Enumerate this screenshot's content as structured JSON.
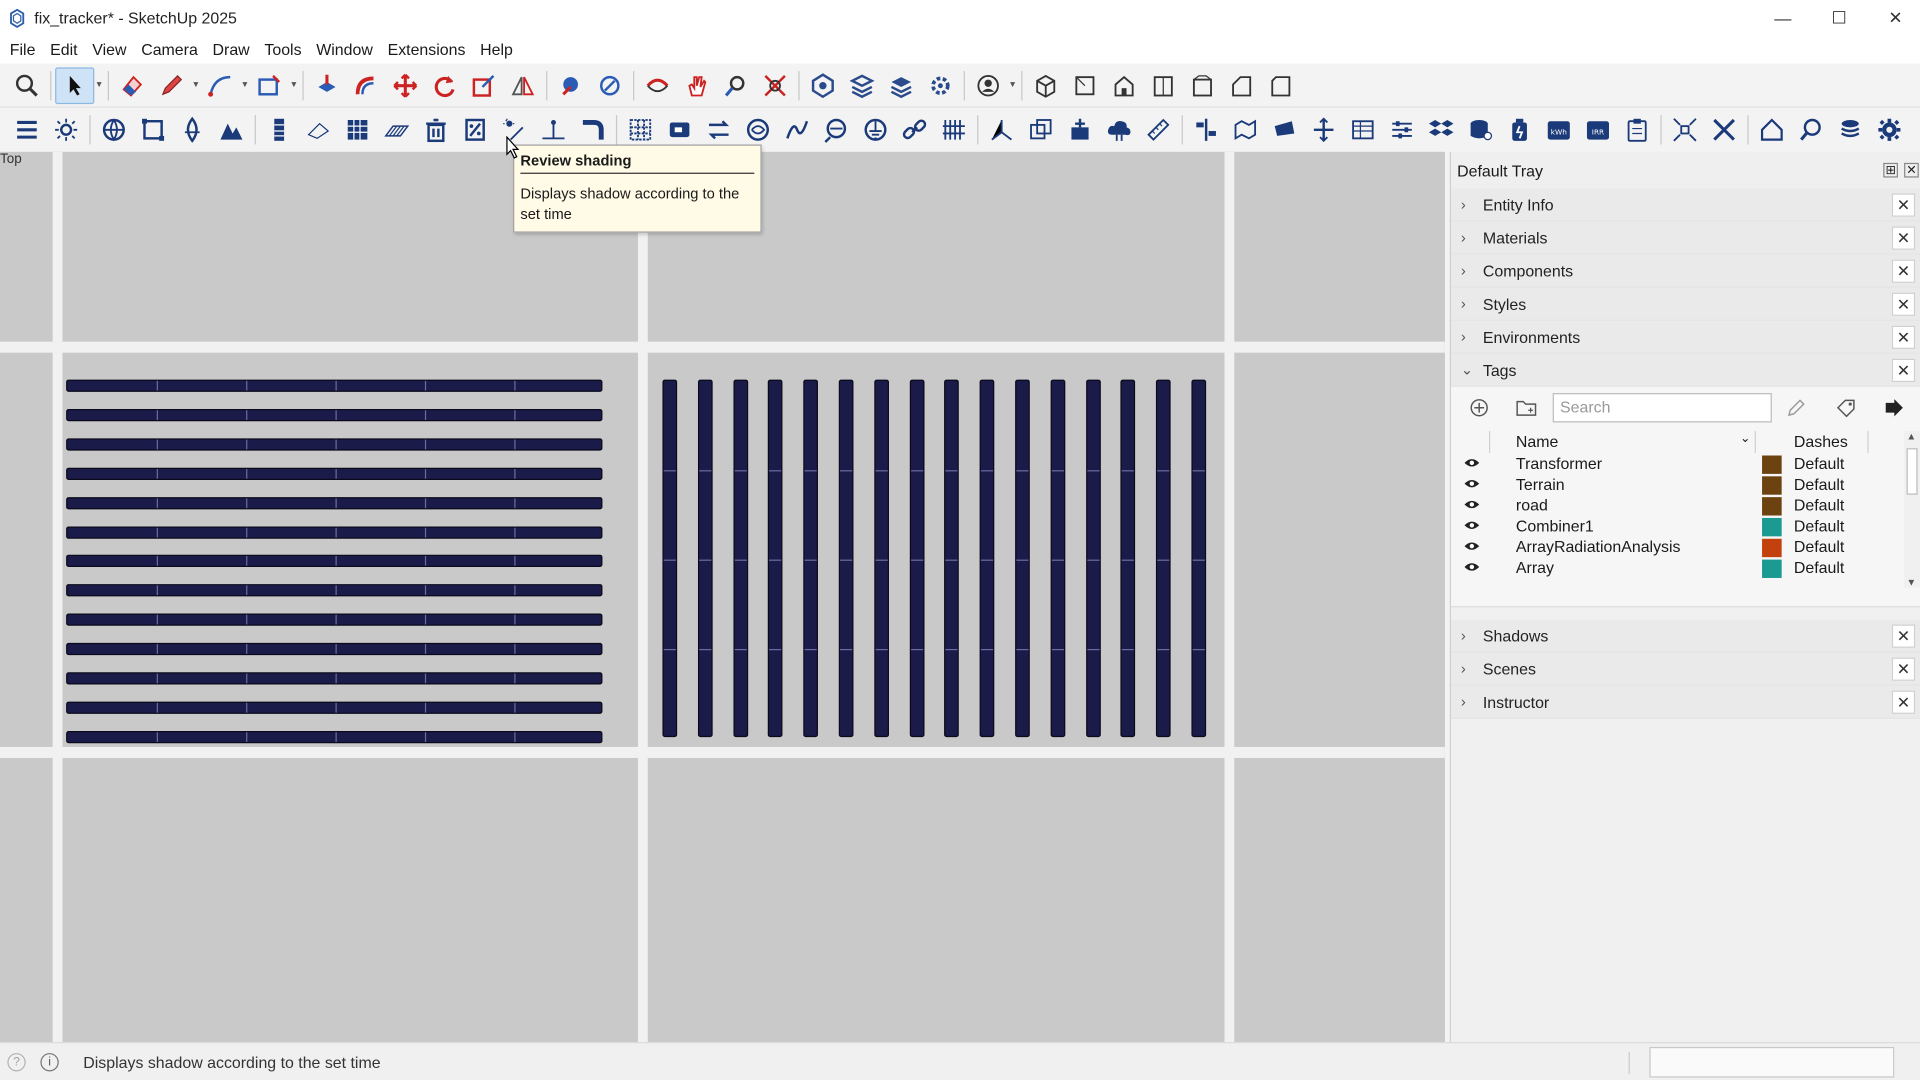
{
  "window": {
    "title": "fix_tracker* - SketchUp 2025",
    "minimize": "—",
    "maximize": "☐",
    "close": "✕"
  },
  "menu": [
    "File",
    "Edit",
    "View",
    "Camera",
    "Draw",
    "Tools",
    "Window",
    "Extensions",
    "Help"
  ],
  "viewport": {
    "view_label": "Top"
  },
  "tooltip": {
    "title": "Review shading",
    "body": "Displays shadow according to the set time"
  },
  "tray": {
    "title": "Default Tray",
    "sections_top": [
      "Entity Info",
      "Materials",
      "Components",
      "Styles",
      "Environments"
    ],
    "tags": {
      "label": "Tags",
      "search_placeholder": "Search",
      "col_name": "Name",
      "col_dashes": "Dashes",
      "rows": [
        {
          "name": "Transformer",
          "color": "#6b4210",
          "dashes": "Default"
        },
        {
          "name": "Terrain",
          "color": "#6b4210",
          "dashes": "Default"
        },
        {
          "name": "road",
          "color": "#6b4210",
          "dashes": "Default"
        },
        {
          "name": "Combiner1",
          "color": "#1a9a90",
          "dashes": "Default"
        },
        {
          "name": "ArrayRadiationAnalysis",
          "color": "#c2410c",
          "dashes": "Default"
        },
        {
          "name": "Array",
          "color": "#1a9a90",
          "dashes": "Default"
        }
      ]
    },
    "sections_bottom": [
      "Shadows",
      "Scenes",
      "Instructor"
    ]
  },
  "status": {
    "text": "Displays shadow according to the set time"
  }
}
